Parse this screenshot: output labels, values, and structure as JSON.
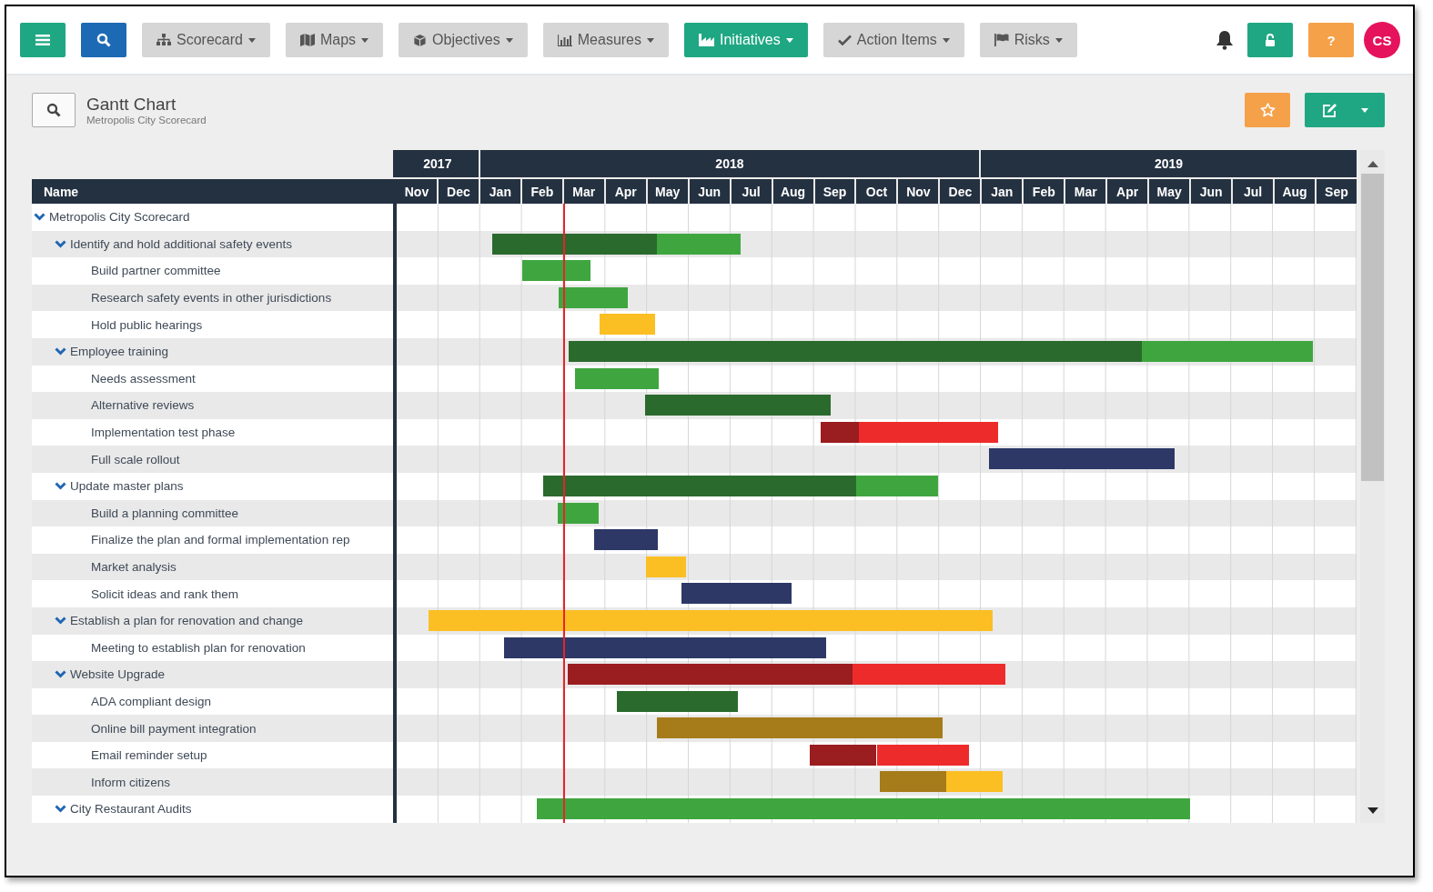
{
  "nav": {
    "items": [
      {
        "label": "Scorecard",
        "selected": false
      },
      {
        "label": "Maps",
        "selected": false
      },
      {
        "label": "Objectives",
        "selected": false
      },
      {
        "label": "Measures",
        "selected": false
      },
      {
        "label": "Initiatives",
        "selected": true
      },
      {
        "label": "Action Items",
        "selected": false
      },
      {
        "label": "Risks",
        "selected": false
      }
    ],
    "help_label": "?",
    "avatar_initials": "CS"
  },
  "page": {
    "title": "Gantt Chart",
    "subtitle": "Metropolis City Scorecard"
  },
  "gantt": {
    "name_header": "Name",
    "years": [
      "2017",
      "2018",
      "2019"
    ],
    "months": [
      "Nov",
      "Dec",
      "Jan",
      "Feb",
      "Mar",
      "Apr",
      "May",
      "Jun",
      "Jul",
      "Aug",
      "Sep",
      "Oct",
      "Nov",
      "Dec",
      "Jan",
      "Feb",
      "Mar",
      "Apr",
      "May",
      "Jun",
      "Jul",
      "Aug",
      "Sep"
    ],
    "tree": {
      "name": "Metropolis City Scorecard",
      "expanded": true,
      "children": [
        {
          "name": "Identify and hold additional safety events",
          "expanded": true,
          "bar_segments": [
            {
              "color": "#2b6a2d"
            },
            {
              "color": "#3fa63f"
            }
          ],
          "children": [
            {
              "name": "Build partner committee",
              "bar_segments": [
                {
                  "color": "#3fa63f"
                }
              ]
            },
            {
              "name": "Research safety events in other jurisdictions",
              "bar_segments": [
                {
                  "color": "#3fa63f"
                }
              ]
            },
            {
              "name": "Hold public hearings",
              "bar_segments": [
                {
                  "color": "#fbbf24"
                }
              ]
            }
          ]
        },
        {
          "name": "Employee training",
          "expanded": true,
          "bar_segments": [
            {
              "color": "#2b6a2d"
            },
            {
              "color": "#3fa63f"
            }
          ],
          "children": [
            {
              "name": "Needs assessment",
              "bar_segments": [
                {
                  "color": "#3fa63f"
                }
              ]
            },
            {
              "name": "Alternative reviews",
              "bar_segments": [
                {
                  "color": "#2b6a2d"
                }
              ]
            },
            {
              "name": "Implementation test phase",
              "bar_segments": [
                {
                  "color": "#9a1d1f"
                },
                {
                  "color": "#ee2b2b"
                }
              ]
            },
            {
              "name": "Full scale rollout",
              "bar_segments": [
                {
                  "color": "#2d3867"
                }
              ]
            }
          ]
        },
        {
          "name": "Update master plans",
          "expanded": true,
          "bar_segments": [
            {
              "color": "#2b6a2d"
            },
            {
              "color": "#3fa63f"
            }
          ],
          "children": [
            {
              "name": "Build a planning committee",
              "bar_segments": [
                {
                  "color": "#3fa63f"
                }
              ]
            },
            {
              "name": "Finalize the plan and formal implementation rep",
              "bar_segments": [
                {
                  "color": "#2d3867"
                }
              ]
            },
            {
              "name": "Market analysis",
              "bar_segments": [
                {
                  "color": "#fbbf24"
                }
              ]
            },
            {
              "name": "Solicit ideas and rank them",
              "bar_segments": [
                {
                  "color": "#2d3867"
                }
              ]
            }
          ]
        },
        {
          "name": "Establish a plan for renovation and change",
          "expanded": true,
          "bar_segments": [
            {
              "color": "#fbbf24"
            }
          ],
          "children": [
            {
              "name": "Meeting to establish plan for renovation",
              "bar_segments": [
                {
                  "color": "#2d3867"
                }
              ]
            }
          ]
        },
        {
          "name": "Website Upgrade",
          "expanded": true,
          "bar_segments": [
            {
              "color": "#9a1d1f"
            },
            {
              "color": "#ee2b2b"
            }
          ],
          "children": [
            {
              "name": "ADA compliant design",
              "bar_segments": [
                {
                  "color": "#2b6a2d"
                }
              ]
            },
            {
              "name": "Online bill payment integration",
              "bar_segments": [
                {
                  "color": "#a67c1a"
                }
              ]
            },
            {
              "name": "Email reminder setup",
              "bar_segments": [
                {
                  "color": "#9a1d1f"
                },
                {
                  "color": "#ee2b2b"
                }
              ]
            },
            {
              "name": "Inform citizens",
              "bar_segments": [
                {
                  "color": "#a67c1a"
                },
                {
                  "color": "#fbbf24"
                }
              ]
            }
          ]
        },
        {
          "name": "City Restaurant Audits",
          "expanded": true,
          "bar_segments": [
            {
              "color": "#3fa63f"
            }
          ]
        }
      ]
    }
  }
}
